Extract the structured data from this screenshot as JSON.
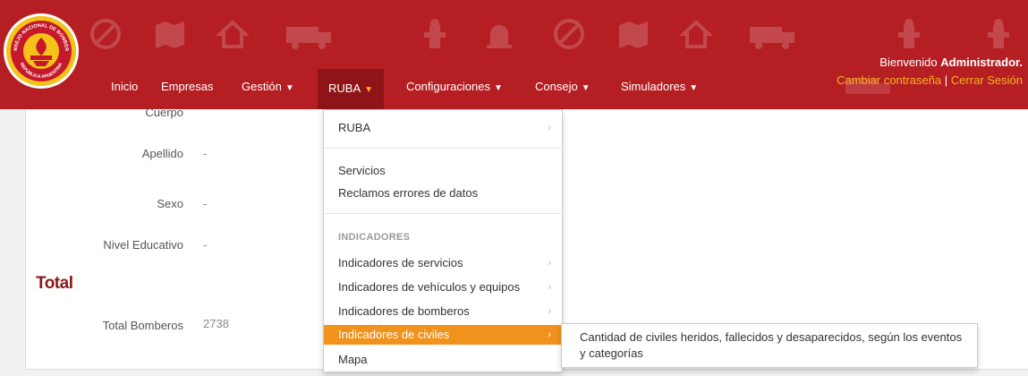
{
  "logo": {
    "ring_text_top": "CONSEJO NACIONAL DE BOMBEROS",
    "ring_text_bottom": "REPÚBLICA ARGENTINA"
  },
  "nav": {
    "items": [
      {
        "label": "Inicio"
      },
      {
        "label": "Empresas"
      },
      {
        "label": "Gestión"
      },
      {
        "label": "RUBA"
      },
      {
        "label": "Configuraciones"
      },
      {
        "label": "Consejo"
      },
      {
        "label": "Simuladores"
      }
    ],
    "welcome_prefix": "Bienvenido",
    "welcome_user": "Administrador.",
    "change_password": "Cambiar contraseña",
    "separator": "|",
    "logout": "Cerrar Sesión"
  },
  "details": {
    "cuerpo_label": "Cuerpo",
    "apellido_label": "Apellido",
    "apellido_value": "-",
    "sexo_label": "Sexo",
    "sexo_value": "-",
    "nivel_label": "Nivel Educativo",
    "nivel_value": "-",
    "total_heading": "Total",
    "total_bomberos_label": "Total Bomberos",
    "total_bomberos_value": "2738"
  },
  "dropdown": {
    "ruba": "RUBA",
    "servicios": "Servicios",
    "reclamos": "Reclamos errores de datos",
    "indicadores_header": "INDICADORES",
    "ind_servicios": "Indicadores de servicios",
    "ind_vehiculos": "Indicadores de vehículos y equipos",
    "ind_bomberos": "Indicadores de bomberos",
    "ind_civiles": "Indicadores de civiles",
    "mapa": "Mapa"
  },
  "submenu": {
    "item": "Cantidad de civiles heridos, fallecidos y desaparecidos, según los eventos y categorías"
  },
  "colors": {
    "brand_red": "#b51f24",
    "accent_orange": "#f0921c",
    "accent_yellow": "#f7b21b"
  }
}
